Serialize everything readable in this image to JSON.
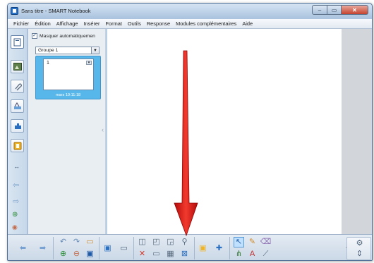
{
  "window": {
    "title": "Sans titre - SMART Notebook",
    "controls": {
      "minimize": "–",
      "maximize": "▭",
      "close": "✕"
    }
  },
  "menu": [
    "Fichier",
    "Édition",
    "Affichage",
    "Insérer",
    "Format",
    "Outils",
    "Response",
    "Modules complémentaires",
    "Aide"
  ],
  "sidebar_tabs": [
    "page-sorter-icon",
    "gallery-icon",
    "attachments-icon",
    "properties-icon",
    "addons-icon",
    "response-icon"
  ],
  "sorter": {
    "auto_hide_label": "Masquer automatiquemen",
    "auto_hide_checked": true,
    "group_value": "Groupe 1",
    "page_number": "1",
    "page_time": "mars 10:11:18"
  },
  "colors": {
    "accent": "#58b7ea",
    "arrow": "#e8110f",
    "chrome": "#b9cfe6"
  },
  "toolbar": {
    "icons": [
      "back-icon",
      "forward-icon",
      "undo-icon",
      "redo-icon",
      "add-page-icon",
      "delete-icon",
      "save-icon",
      "paste-icon",
      "screen-icon",
      "screen-shade-icon",
      "fullscreen-icon",
      "table-icon",
      "capture-icon",
      "document-camera-icon",
      "response-icon",
      "addons-icon",
      "select-icon",
      "pen-icon",
      "eraser-icon",
      "creative-pen-icon",
      "text-icon",
      "line-icon",
      "more-icon",
      "settings-icon",
      "move-toolbar-icon"
    ]
  },
  "annotation": {
    "type": "red-down-arrow"
  }
}
